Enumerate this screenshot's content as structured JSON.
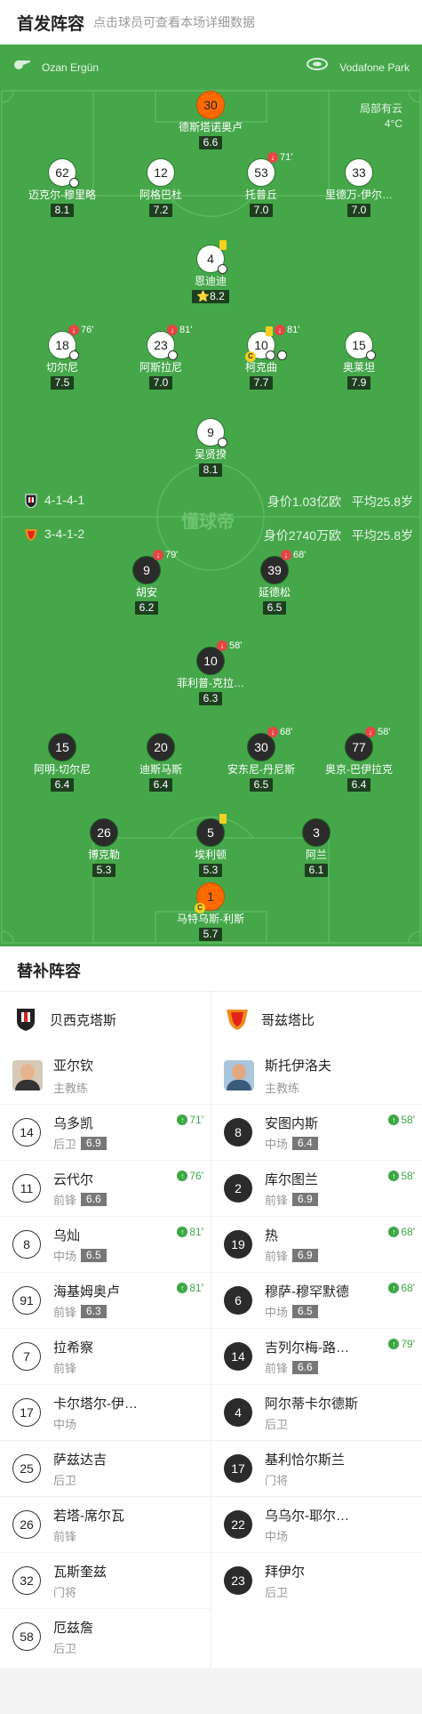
{
  "header": {
    "title": "首发阵容",
    "subtitle": "点击球员可查看本场详细数据"
  },
  "pitch": {
    "referee": "Ozan Ergün",
    "venue": "Vodafone Park",
    "weather": "局部有云",
    "temperature": "4°C",
    "watermark": "懂球帝"
  },
  "home_team": {
    "formation": "4-1-4-1",
    "value_label": "身价1.03亿欧",
    "age_label": "平均25.8岁"
  },
  "away_team": {
    "formation": "3-4-1-2",
    "value_label": "身价2740万欧",
    "age_label": "平均25.8岁"
  },
  "home_players": [
    {
      "number": "30",
      "name": "德斯塔诺奥卢",
      "rating": "6.6"
    },
    {
      "number": "62",
      "name": "迈克尔-穆里略",
      "rating": "8.1"
    },
    {
      "number": "12",
      "name": "阿格巴杜",
      "rating": "7.2"
    },
    {
      "number": "53",
      "name": "托普丘",
      "rating": "7.0",
      "sub_minute": "71'"
    },
    {
      "number": "33",
      "name": "里德万-伊尔…",
      "rating": "7.0"
    },
    {
      "number": "4",
      "name": "恩迪迪",
      "rating": "8.2",
      "star": "⭐"
    },
    {
      "number": "18",
      "name": "切尔尼",
      "rating": "7.5",
      "sub_minute": "76'"
    },
    {
      "number": "23",
      "name": "阿斯拉尼",
      "rating": "7.0",
      "sub_minute": "81'"
    },
    {
      "number": "10",
      "name": "柯克曲",
      "rating": "7.7",
      "sub_minute": "81'",
      "captain": "C"
    },
    {
      "number": "15",
      "name": "奥莱坦",
      "rating": "7.9"
    },
    {
      "number": "9",
      "name": "吴贤揆",
      "rating": "8.1"
    }
  ],
  "away_players": [
    {
      "number": "9",
      "name": "胡安",
      "rating": "6.2",
      "sub_minute": "79'"
    },
    {
      "number": "39",
      "name": "延德松",
      "rating": "6.5",
      "sub_minute": "68'"
    },
    {
      "number": "10",
      "name": "菲利普-克拉…",
      "rating": "6.3",
      "sub_minute": "58'"
    },
    {
      "number": "15",
      "name": "阿明-切尔尼",
      "rating": "6.4"
    },
    {
      "number": "20",
      "name": "迪斯马斯",
      "rating": "6.4"
    },
    {
      "number": "30",
      "name": "安东尼-丹尼斯",
      "rating": "6.5",
      "sub_minute": "68'"
    },
    {
      "number": "77",
      "name": "奥京-巴伊拉克",
      "rating": "6.4",
      "sub_minute": "58'"
    },
    {
      "number": "26",
      "name": "博克勒",
      "rating": "5.3"
    },
    {
      "number": "5",
      "name": "埃利顿",
      "rating": "5.3"
    },
    {
      "number": "3",
      "name": "阿兰",
      "rating": "6.1"
    },
    {
      "number": "1",
      "name": "马特乌斯-利斯",
      "rating": "5.7",
      "captain": "C"
    }
  ],
  "subs": {
    "title": "替补阵容",
    "home": {
      "team": "贝西克塔斯",
      "coach": {
        "name": "亚尔钦",
        "role": "主教练"
      },
      "players": [
        {
          "number": "14",
          "name": "乌多凯",
          "pos": "后卫",
          "rating": "6.9",
          "minute": "71'"
        },
        {
          "number": "11",
          "name": "云代尔",
          "pos": "前锋",
          "rating": "6.6",
          "minute": "76'"
        },
        {
          "number": "8",
          "name": "乌灿",
          "pos": "中场",
          "rating": "6.5",
          "minute": "81'"
        },
        {
          "number": "91",
          "name": "海基姆奥卢",
          "pos": "前锋",
          "rating": "6.3",
          "minute": "81'"
        },
        {
          "number": "7",
          "name": "拉希察",
          "pos": "前锋"
        },
        {
          "number": "17",
          "name": "卡尔塔尔-伊…",
          "pos": "中场"
        },
        {
          "number": "25",
          "name": "萨兹达吉",
          "pos": "后卫"
        },
        {
          "number": "26",
          "name": "若塔-席尔瓦",
          "pos": "前锋"
        },
        {
          "number": "32",
          "name": "瓦斯奎兹",
          "pos": "门将"
        },
        {
          "number": "58",
          "name": "厄兹詹",
          "pos": "后卫"
        }
      ]
    },
    "away": {
      "team": "哥兹塔比",
      "coach": {
        "name": "斯托伊洛夫",
        "role": "主教练"
      },
      "players": [
        {
          "number": "8",
          "name": "安图内斯",
          "pos": "中场",
          "rating": "6.4",
          "minute": "58'"
        },
        {
          "number": "2",
          "name": "库尔图兰",
          "pos": "前锋",
          "rating": "6.9",
          "minute": "58'"
        },
        {
          "number": "19",
          "name": "热",
          "pos": "前锋",
          "rating": "6.9",
          "minute": "68'"
        },
        {
          "number": "6",
          "name": "穆萨-穆罕默德",
          "pos": "中场",
          "rating": "6.5",
          "minute": "68'"
        },
        {
          "number": "14",
          "name": "吉列尔梅-路…",
          "pos": "前锋",
          "rating": "6.6",
          "minute": "79'"
        },
        {
          "number": "4",
          "name": "阿尔蒂卡尔德斯",
          "pos": "后卫"
        },
        {
          "number": "17",
          "name": "基利恰尔斯兰",
          "pos": "门将"
        },
        {
          "number": "22",
          "name": "乌乌尔-耶尔…",
          "pos": "中场"
        },
        {
          "number": "23",
          "name": "拜伊尔",
          "pos": "后卫"
        }
      ]
    }
  },
  "colors": {
    "pitch": "#45a74a",
    "sub_out": "#e64545",
    "sub_in": "#3ca843",
    "captain": "#f5d020",
    "gk": "#ff6a00"
  }
}
